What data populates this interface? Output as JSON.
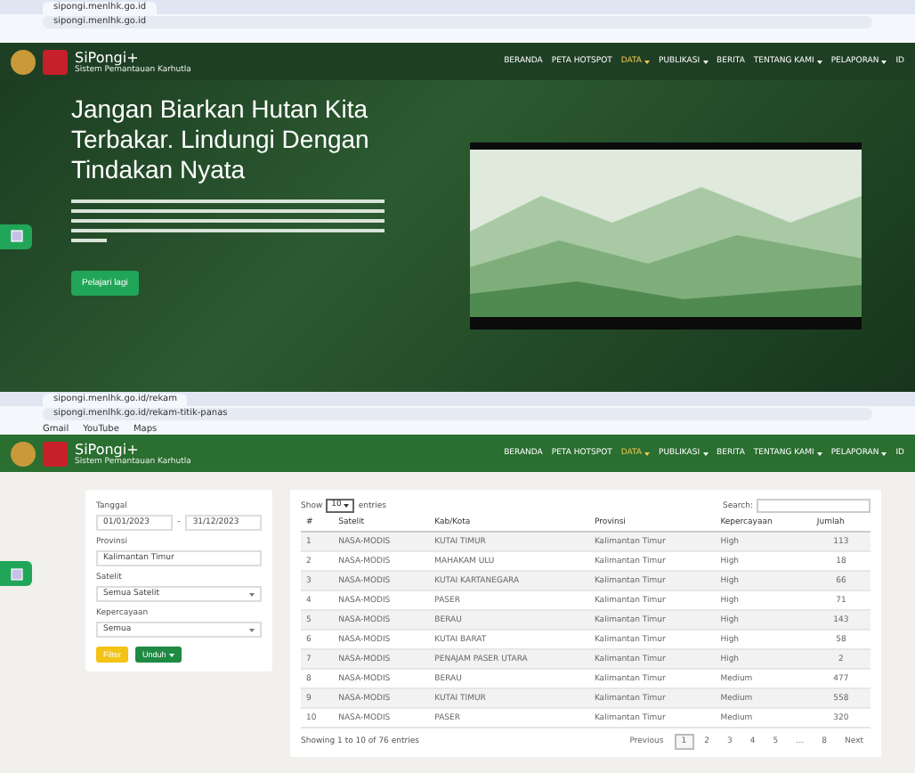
{
  "windows": [
    {
      "address": "sipongi.menlhk.go.id",
      "tab": "sipongi.menlhk.go.id",
      "site": {
        "name": "SiPongi+",
        "subtitle": "Sistem Pemantauan Karhutla",
        "nav": [
          {
            "label": "BERANDA",
            "selected": false,
            "dropdown": false
          },
          {
            "label": "PETA HOTSPOT",
            "selected": false,
            "dropdown": false
          },
          {
            "label": "DATA",
            "selected": true,
            "dropdown": true
          },
          {
            "label": "PUBLIKASI",
            "selected": false,
            "dropdown": true
          },
          {
            "label": "BERITA",
            "selected": false,
            "dropdown": false
          },
          {
            "label": "TENTANG KAMI",
            "selected": false,
            "dropdown": true
          },
          {
            "label": "PELAPORAN",
            "selected": false,
            "dropdown": true
          }
        ],
        "lang": "ID"
      },
      "kind": "hero",
      "hero": {
        "title": "Jangan Biarkan Hutan Kita Terbakar. Lindungi Dengan Tindakan Nyata",
        "button": "Pelajari lagi"
      }
    },
    {
      "address": "sipongi.menlhk.go.id/rekam-titik-panas",
      "tab": "sipongi.menlhk.go.id/rekam",
      "bookmarks": [
        "Gmail",
        "YouTube",
        "Maps"
      ],
      "site": {
        "name": "SiPongi+",
        "subtitle": "Sistem Pemantauan Karhutla",
        "nav": [
          {
            "label": "BERANDA",
            "selected": false,
            "dropdown": false
          },
          {
            "label": "PETA HOTSPOT",
            "selected": false,
            "dropdown": false
          },
          {
            "label": "DATA",
            "selected": true,
            "dropdown": true
          },
          {
            "label": "PUBLIKASI",
            "selected": false,
            "dropdown": true
          },
          {
            "label": "BERITA",
            "selected": false,
            "dropdown": false
          },
          {
            "label": "TENTANG KAMI",
            "selected": false,
            "dropdown": true
          },
          {
            "label": "PELAPORAN",
            "selected": false,
            "dropdown": true
          }
        ],
        "lang": "ID"
      },
      "kind": "data",
      "filter": {
        "date_label": "Tanggal",
        "date_from": "01/01/2023",
        "date_sep": "-",
        "date_to": "31/12/2023",
        "province_label": "Provinsi",
        "province": "Kalimantan Timur",
        "satellite_label": "Satelit",
        "satellite": "Semua Satelit",
        "confidence_label": "Kepercayaan",
        "confidence": "Semua",
        "filter_button": "Filter",
        "download_button": "Unduh"
      },
      "table": {
        "show_label": "Show",
        "page_size": "10",
        "entries_label": "entries",
        "search_label": "Search:",
        "columns": [
          "#",
          "Satelit",
          "Kab/Kota",
          "Provinsi",
          "Kepercayaan",
          "Jumlah"
        ],
        "rows": [
          [
            "1",
            "NASA-MODIS",
            "KUTAI TIMUR",
            "Kalimantan Timur",
            "High",
            "113"
          ],
          [
            "2",
            "NASA-MODIS",
            "MAHAKAM ULU",
            "Kalimantan Timur",
            "High",
            "18"
          ],
          [
            "3",
            "NASA-MODIS",
            "KUTAI KARTANEGARA",
            "Kalimantan Timur",
            "High",
            "66"
          ],
          [
            "4",
            "NASA-MODIS",
            "PASER",
            "Kalimantan Timur",
            "High",
            "71"
          ],
          [
            "5",
            "NASA-MODIS",
            "BERAU",
            "Kalimantan Timur",
            "High",
            "143"
          ],
          [
            "6",
            "NASA-MODIS",
            "KUTAI BARAT",
            "Kalimantan Timur",
            "High",
            "58"
          ],
          [
            "7",
            "NASA-MODIS",
            "PENAJAM PASER UTARA",
            "Kalimantan Timur",
            "High",
            "2"
          ],
          [
            "8",
            "NASA-MODIS",
            "BERAU",
            "Kalimantan Timur",
            "Medium",
            "477"
          ],
          [
            "9",
            "NASA-MODIS",
            "KUTAI TIMUR",
            "Kalimantan Timur",
            "Medium",
            "558"
          ],
          [
            "10",
            "NASA-MODIS",
            "PASER",
            "Kalimantan Timur",
            "Medium",
            "320"
          ]
        ],
        "info": "Showing 1 to 10 of 76 entries",
        "pages": [
          {
            "label": "Previous",
            "selected": false
          },
          {
            "label": "1",
            "selected": true
          },
          {
            "label": "2",
            "selected": false
          },
          {
            "label": "3",
            "selected": false
          },
          {
            "label": "4",
            "selected": false
          },
          {
            "label": "5",
            "selected": false
          },
          {
            "label": "…",
            "selected": false
          },
          {
            "label": "8",
            "selected": false
          },
          {
            "label": "Next",
            "selected": false
          }
        ]
      }
    }
  ]
}
